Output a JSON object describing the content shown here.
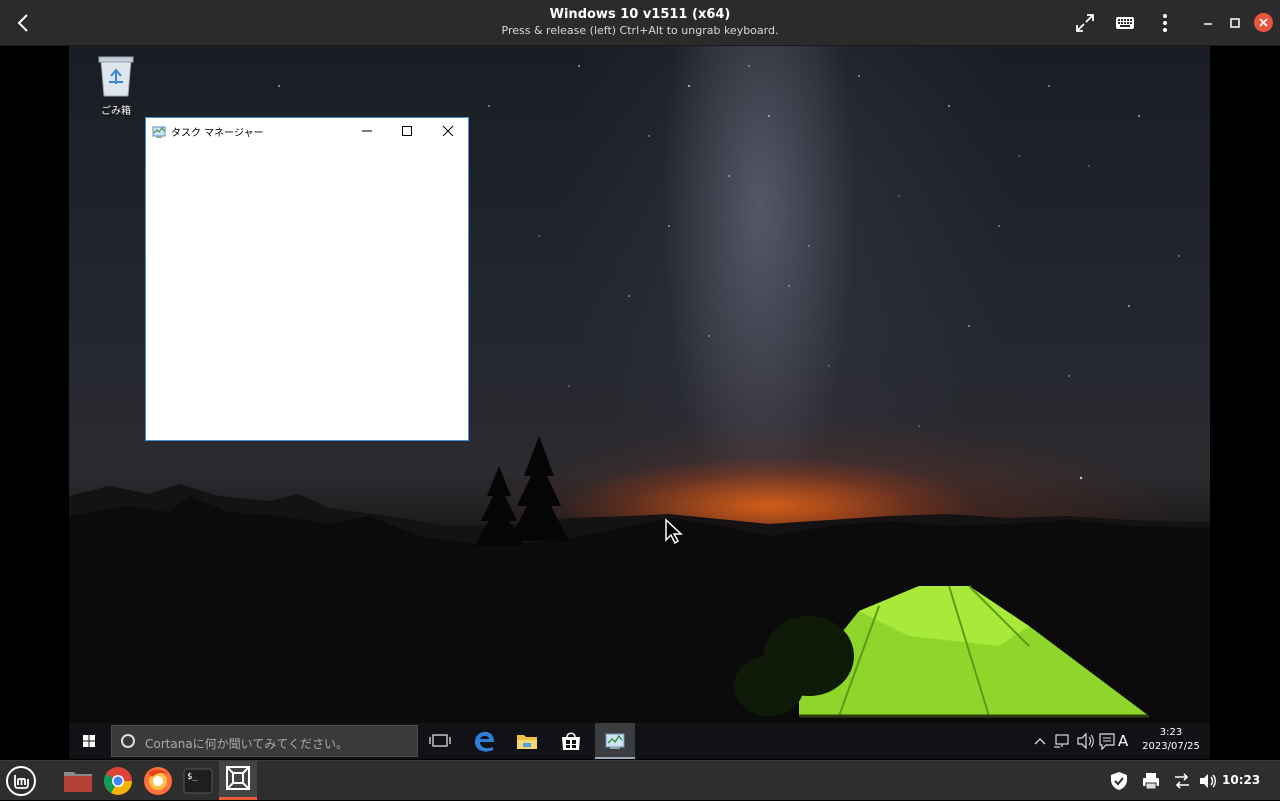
{
  "vm_viewer": {
    "title": "Windows 10 v1511 (x64)",
    "subtitle": "Press & release (left) Ctrl+Alt to ungrab keyboard.",
    "icons": [
      "back-arrow-icon",
      "fullscreen-icon",
      "keyboard-icon",
      "kebab-menu-icon",
      "minimize-icon",
      "maximize-icon",
      "close-icon"
    ]
  },
  "desktop": {
    "recycle_bin_label": "ごみ箱"
  },
  "task_manager": {
    "title": "タスク マネージャー"
  },
  "windows_taskbar": {
    "cortana_placeholder": "Cortanaに何か聞いてみてください。",
    "ime_indicator": "A",
    "clock_time": "3:23",
    "clock_date": "2023/07/25",
    "pinned": [
      "task-view-icon",
      "edge-icon",
      "file-explorer-icon",
      "store-icon",
      "task-manager-icon"
    ]
  },
  "host_panel": {
    "clock": "10:23",
    "apps": [
      "mint-menu-icon",
      "files-icon",
      "chrome-icon",
      "firefox-icon",
      "terminal-icon",
      "virt-viewer-icon"
    ],
    "tray": [
      "shield-icon",
      "printer-icon",
      "network-icon",
      "volume-icon"
    ],
    "accent_color": "#e85c33"
  }
}
